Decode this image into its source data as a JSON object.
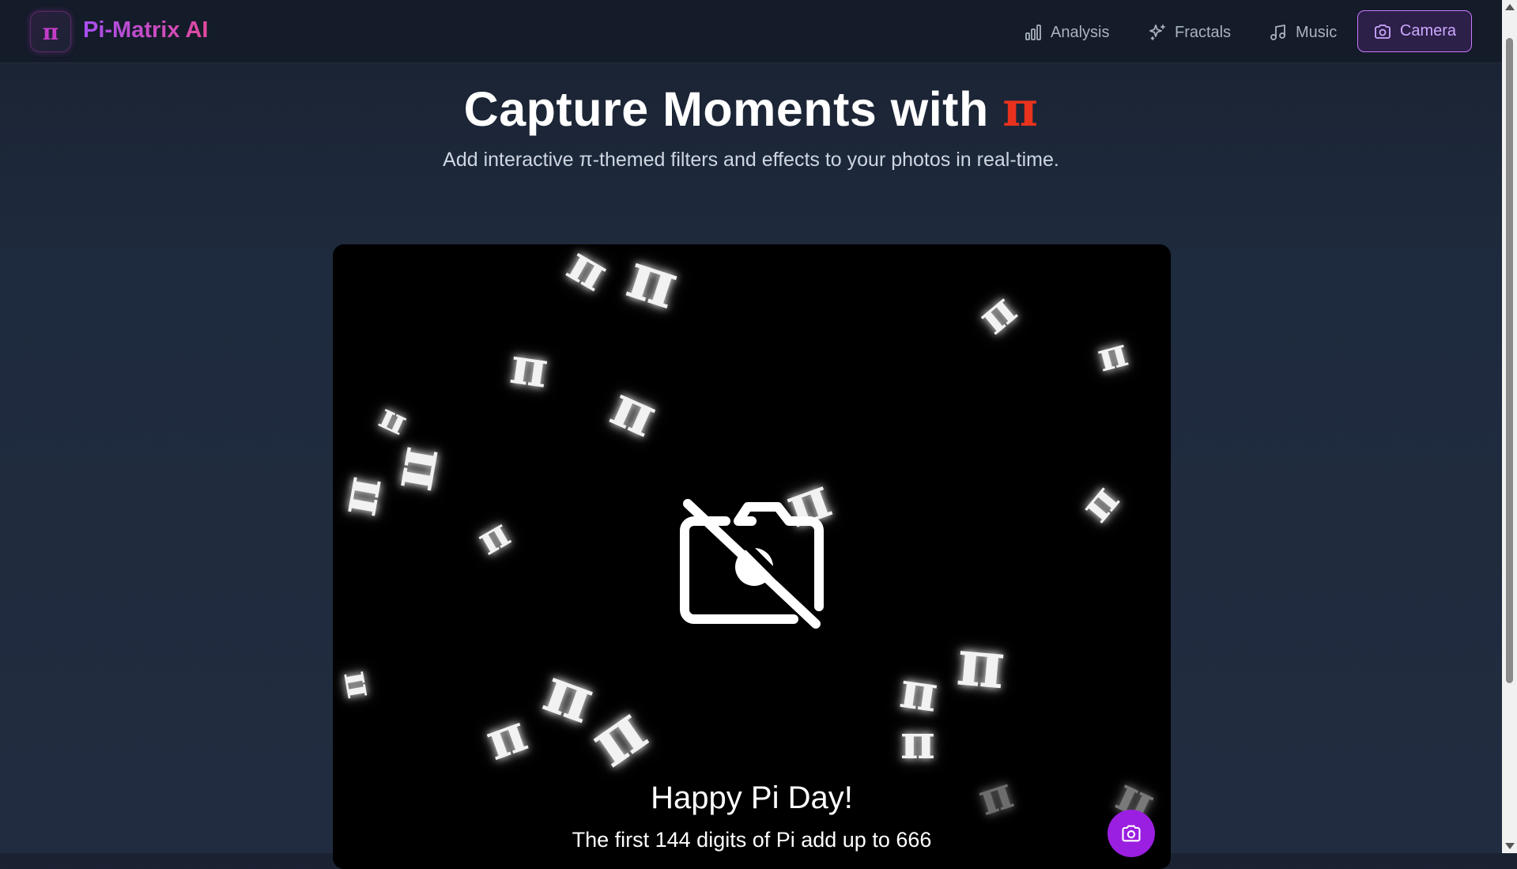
{
  "brand": {
    "logo_symbol": "π",
    "name": "Pi-Matrix AI"
  },
  "nav": {
    "items": [
      {
        "label": "Analysis",
        "icon": "bar-chart-icon"
      },
      {
        "label": "Fractals",
        "icon": "sparkles-icon"
      },
      {
        "label": "Music",
        "icon": "music-note-icon"
      }
    ],
    "active": {
      "label": "Camera",
      "icon": "camera-icon"
    }
  },
  "hero": {
    "title": "Capture Moments with",
    "title_symbol": "π",
    "subtitle": "Add interactive π-themed filters and effects to your photos in real-time."
  },
  "camera": {
    "status_icon": "camera-off-icon",
    "overlay_symbol": "π",
    "caption_title": "Happy Pi Day!",
    "caption_fact": "The first 144 digits of Pi add up to 666",
    "capture_icon": "camera-icon"
  },
  "colors": {
    "accent": "#9b1fe0",
    "pi_red": "#e8321e",
    "brand_gradient_start": "#a64ef0",
    "brand_gradient_end": "#e24a9d"
  }
}
